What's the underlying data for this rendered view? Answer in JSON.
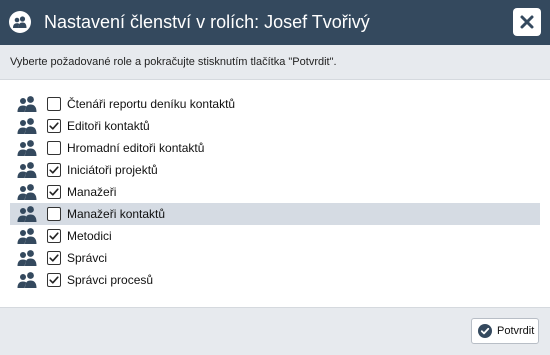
{
  "dialog": {
    "title": "Nastavení členství v rolích: Josef Tvořivý",
    "instruction": "Vyberte požadované role a pokračujte stisknutím tlačítka \"Potvrdit\".",
    "header_color": "#34495e",
    "icons": {
      "title": "users-icon",
      "close": "close-icon",
      "confirm": "check-circle-icon"
    }
  },
  "roles": [
    {
      "label": "Čtenáři reportu deníku kontaktů",
      "checked": false,
      "highlighted": false
    },
    {
      "label": "Editoři kontaktů",
      "checked": true,
      "highlighted": false
    },
    {
      "label": "Hromadní editoři kontaktů",
      "checked": false,
      "highlighted": false
    },
    {
      "label": "Iniciátoři projektů",
      "checked": true,
      "highlighted": false
    },
    {
      "label": "Manažeři",
      "checked": true,
      "highlighted": false
    },
    {
      "label": "Manažeři kontaktů",
      "checked": false,
      "highlighted": true
    },
    {
      "label": "Metodici",
      "checked": true,
      "highlighted": false
    },
    {
      "label": "Správci",
      "checked": true,
      "highlighted": false
    },
    {
      "label": "Správci procesů",
      "checked": true,
      "highlighted": false
    }
  ],
  "footer": {
    "confirm_label": "Potvrdit"
  }
}
